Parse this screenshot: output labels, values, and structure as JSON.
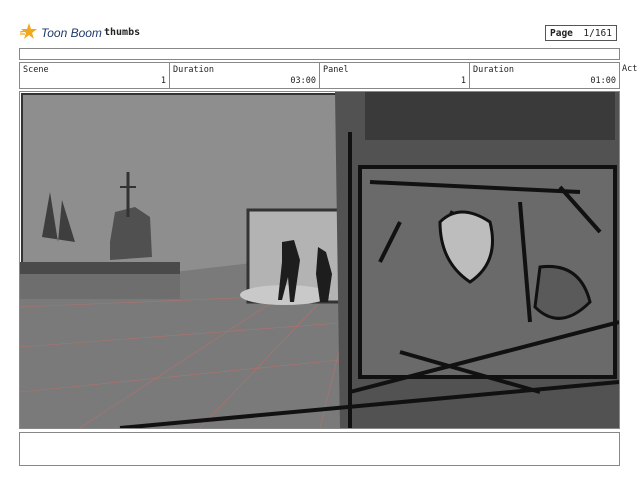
{
  "header": {
    "logo_text": "Toon Boom",
    "doc_name": "thumbs",
    "page_label": "Page",
    "page_value": "1/161"
  },
  "fields": {
    "scene_label": "Scene",
    "scene_value": "1",
    "duration_label": "Duration",
    "duration_value": "03:00",
    "panel_label": "Panel",
    "panel_value": "1",
    "panel_duration_label": "Duration",
    "panel_duration_value": "01:00",
    "action_label": "Act"
  },
  "colors": {
    "logo_star": "#f2a81d",
    "logo_text": "#1f3a6b",
    "sketch_background": "#8e8e8e",
    "perspective_guides": "#c0706a"
  }
}
